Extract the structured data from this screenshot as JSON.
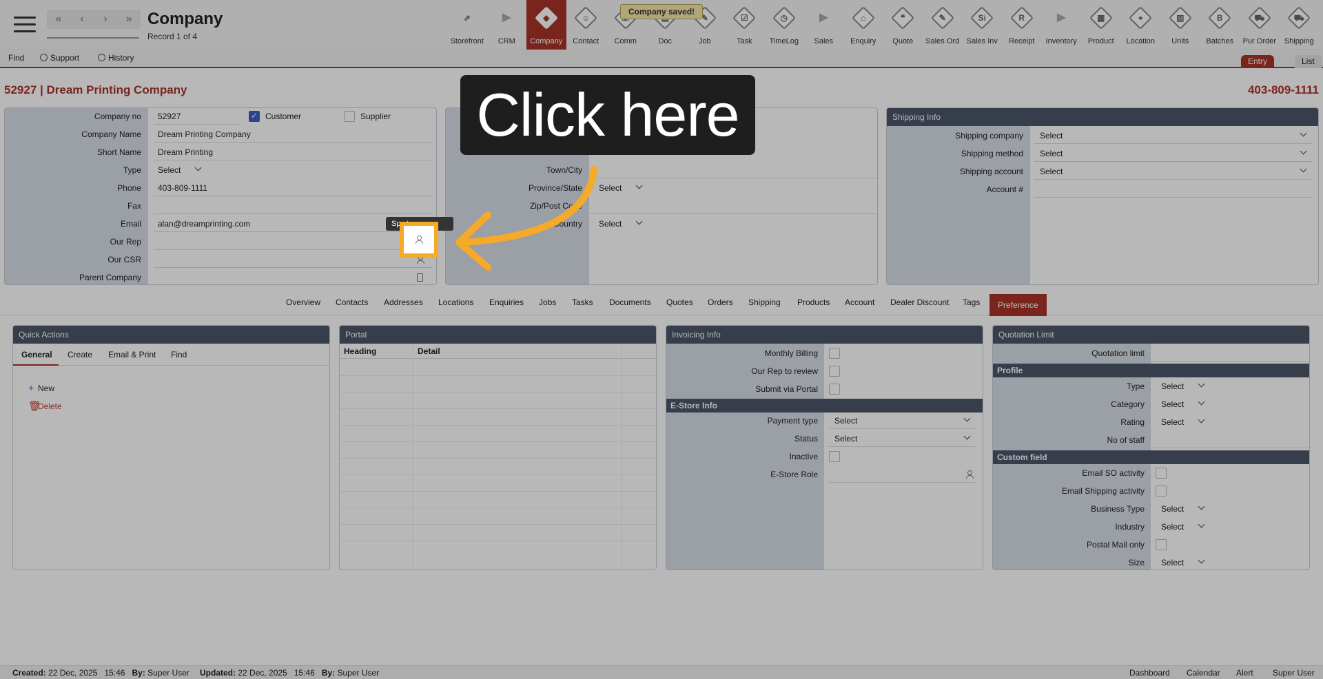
{
  "header": {
    "module_title": "Company",
    "record_position": "Record 1 of 4",
    "toast": "Company saved!",
    "nav_buttons": [
      "«",
      "‹",
      "›",
      "»"
    ]
  },
  "modules": [
    {
      "label": "Storefront",
      "icon": "external-link-icon",
      "glyph": "⇗",
      "style": "plain"
    },
    {
      "label": "CRM",
      "icon": "section-triangle-icon",
      "glyph": "▶",
      "style": "tri"
    },
    {
      "label": "Company",
      "icon": "company-icon",
      "glyph": "◆",
      "style": "active"
    },
    {
      "label": "Contact",
      "icon": "contact-icon",
      "glyph": "☺",
      "style": "dia"
    },
    {
      "label": "Comm",
      "icon": "comm-icon",
      "glyph": "☏",
      "style": "dia"
    },
    {
      "label": "Doc",
      "icon": "doc-icon",
      "glyph": "▤",
      "style": "dia"
    },
    {
      "label": "Job",
      "icon": "job-icon",
      "glyph": "✎",
      "style": "dia"
    },
    {
      "label": "Task",
      "icon": "task-icon",
      "glyph": "☑",
      "style": "dia"
    },
    {
      "label": "TimeLog",
      "icon": "clock-icon",
      "glyph": "◷",
      "style": "dia"
    },
    {
      "label": "Sales",
      "icon": "section-triangle-icon",
      "glyph": "▶",
      "style": "tri"
    },
    {
      "label": "Enquiry",
      "icon": "enquiry-icon",
      "glyph": "⌂",
      "style": "dia"
    },
    {
      "label": "Quote",
      "icon": "quote-icon",
      "glyph": "❝",
      "style": "dia"
    },
    {
      "label": "Sales Ord",
      "icon": "sales-order-icon",
      "glyph": "✎",
      "style": "dia"
    },
    {
      "label": "Sales Inv",
      "icon": "sales-invoice-icon",
      "glyph": "Si",
      "style": "dia"
    },
    {
      "label": "Receipt",
      "icon": "receipt-icon",
      "glyph": "R",
      "style": "dia"
    },
    {
      "label": "Inventory",
      "icon": "section-triangle-icon",
      "glyph": "▶",
      "style": "tri"
    },
    {
      "label": "Product",
      "icon": "product-icon",
      "glyph": "▦",
      "style": "dia"
    },
    {
      "label": "Location",
      "icon": "location-icon",
      "glyph": "⌖",
      "style": "dia"
    },
    {
      "label": "Units",
      "icon": "units-icon",
      "glyph": "▥",
      "style": "dia"
    },
    {
      "label": "Batches",
      "icon": "batches-icon",
      "glyph": "B",
      "style": "dia"
    },
    {
      "label": "Pur Order",
      "icon": "cart-icon",
      "glyph": "⛟",
      "style": "dia"
    },
    {
      "label": "Shipping",
      "icon": "truck-icon",
      "glyph": "⛟",
      "style": "dia"
    }
  ],
  "subbar": {
    "find": "Find",
    "support": "Support",
    "history": "History",
    "entry": "Entry",
    "list": "List"
  },
  "record": {
    "title": "52927 | Dream Printing Company",
    "phone": "403-809-1111"
  },
  "company_panel": {
    "company_no_label": "Company no",
    "company_no": "52927",
    "customer_label": "Customer",
    "customer_checked": true,
    "supplier_label": "Supplier",
    "supplier_checked": false,
    "company_name_label": "Company Name",
    "company_name": "Dream Printing Company",
    "short_name_label": "Short Name",
    "short_name": "Dream Printing",
    "type_label": "Type",
    "type_value": "Select",
    "phone_label": "Phone",
    "phone": "403-809-1111",
    "fax_label": "Fax",
    "fax": "",
    "email_label": "Email",
    "email": "alan@dreamprinting.com",
    "our_rep_label": "Our Rep",
    "our_csr_label": "Our CSR",
    "parent_label": "Parent Company"
  },
  "address_panel": {
    "town_label": "Town/City",
    "province_label": "Province/State",
    "province_value": "Select",
    "zip_label": "Zip/Post Code",
    "country_label": "Country",
    "country_value": "Select"
  },
  "shipping_panel": {
    "title": "Shipping Info",
    "shipping_company_label": "Shipping company",
    "shipping_company": "Select",
    "shipping_method_label": "Shipping method",
    "shipping_method": "Select",
    "shipping_account_label": "Shipping account",
    "shipping_account": "Select",
    "account_no_label": "Account #"
  },
  "tabs": [
    "Overview",
    "Contacts",
    "Addresses",
    "Locations",
    "Enquiries",
    "Jobs",
    "Tasks",
    "Documents",
    "Quotes",
    "Orders",
    "Shipping",
    "Products",
    "Account",
    "Dealer Discount",
    "Tags",
    "Preference"
  ],
  "active_tab": "Preference",
  "quick_actions": {
    "title": "Quick Actions",
    "tabs": [
      "General",
      "Create",
      "Email & Print",
      "Find"
    ],
    "new": "New",
    "delete": "Delete"
  },
  "portal": {
    "title": "Portal",
    "heading": "Heading",
    "detail": "Detail"
  },
  "invoicing": {
    "title": "Invoicing Info",
    "monthly_billing": "Monthly Billing",
    "our_rep_review": "Our Rep to review",
    "submit_portal": "Submit via Portal",
    "estore_title": "E-Store Info",
    "payment_type_label": "Payment type",
    "payment_type": "Select",
    "status_label": "Status",
    "status": "Select",
    "inactive_label": "Inactive",
    "estore_role_label": "E-Store Role"
  },
  "quotation": {
    "title": "Quotation Limit",
    "limit_label": "Quotation limit",
    "profile_title": "Profile",
    "type_label": "Type",
    "type": "Select",
    "category_label": "Category",
    "category": "Select",
    "rating_label": "Rating",
    "rating": "Select",
    "staff_label": "No of staff",
    "custom_title": "Custom field",
    "email_so_label": "Email SO activity",
    "email_ship_label": "Email Shipping activity",
    "business_type_label": "Business Type",
    "business_type": "Select",
    "industry_label": "Industry",
    "industry": "Select",
    "postal_label": "Postal Mail only",
    "size_label": "Size",
    "size": "Select"
  },
  "footer": {
    "created_label": "Created:",
    "created": "22 Dec, 2025",
    "created_time": "15:46",
    "by_label": "By:",
    "created_by": "Super User",
    "updated_label": "Updated:",
    "updated": "22 Dec, 2025",
    "updated_time": "15:46",
    "updated_by": "Super User",
    "dashboard": "Dashboard",
    "calendar": "Calendar",
    "alert": "Alert",
    "user": "Super User"
  },
  "overlay": {
    "callout": "Click here",
    "tooltip": "Sp      ct"
  },
  "colors": {
    "accent": "#a8342a",
    "panel_header": "#4b5569",
    "label_column": "#d7dde6",
    "highlight": "#f7a928",
    "checkbox": "#3b5fc7"
  }
}
